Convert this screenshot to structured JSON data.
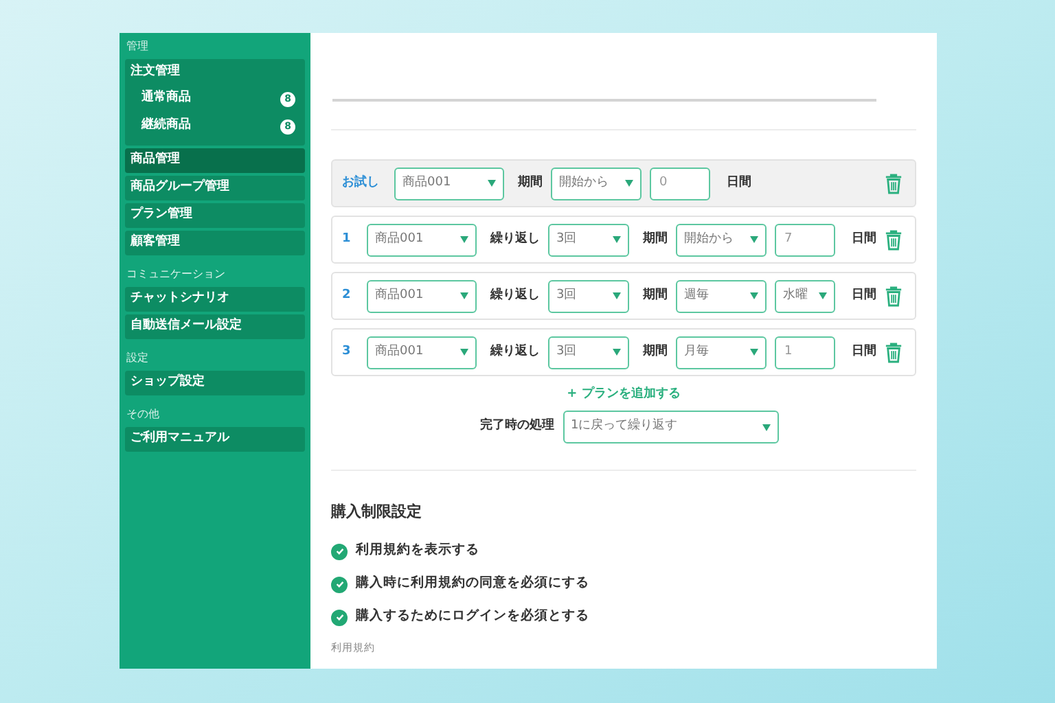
{
  "sidebar": {
    "sections": [
      {
        "label": "管理",
        "items": [
          {
            "label": "注文管理",
            "selected": false,
            "children": [
              {
                "label": "通常商品",
                "badge": "8",
                "selected": false
              },
              {
                "label": "継続商品",
                "badge": "8",
                "selected": false
              }
            ]
          },
          {
            "label": "商品管理",
            "selected": true
          },
          {
            "label": "商品グループ管理",
            "selected": false
          },
          {
            "label": "プラン管理",
            "selected": false
          },
          {
            "label": "顧客管理",
            "selected": false
          }
        ]
      },
      {
        "label": "コミュニケーション",
        "items": [
          {
            "label": "チャットシナリオ",
            "selected": false
          },
          {
            "label": "自動送信メール設定",
            "selected": false
          }
        ]
      },
      {
        "label": "設定",
        "items": [
          {
            "label": "ショップ設定",
            "selected": false
          }
        ]
      },
      {
        "label": "その他",
        "items": [
          {
            "label": "ご利用マニュアル",
            "selected": false
          }
        ]
      }
    ]
  },
  "plans": [
    {
      "kind": "trial",
      "label": "お試し",
      "product": "商品001",
      "period_label": "期間",
      "period": "開始から",
      "amount": {
        "kind": "input",
        "value": "0"
      },
      "unit": "日間"
    },
    {
      "kind": "repeat",
      "label": "1",
      "product": "商品001",
      "repeat_label": "繰り返し",
      "repeat": "3回",
      "period_label": "期間",
      "period": "開始から",
      "amount": {
        "kind": "input",
        "value": "7"
      },
      "unit": "日間"
    },
    {
      "kind": "repeat",
      "label": "2",
      "product": "商品001",
      "repeat_label": "繰り返し",
      "repeat": "3回",
      "period_label": "期間",
      "period": "週毎",
      "amount": {
        "kind": "select",
        "value": "水曜"
      },
      "unit": "日間"
    },
    {
      "kind": "repeat",
      "label": "3",
      "product": "商品001",
      "repeat_label": "繰り返し",
      "repeat": "3回",
      "period_label": "期間",
      "period": "月毎",
      "amount": {
        "kind": "input",
        "value": "1"
      },
      "unit": "日間"
    }
  ],
  "add_plan": "+ プランを追加する",
  "completion": {
    "label": "完了時の処理",
    "value": "1に戻って繰り返す"
  },
  "purchase_limits": {
    "title": "購入制限設定",
    "options": [
      {
        "label": "利用規約を表示する",
        "checked": true
      },
      {
        "label": "購入時に利用規約の同意を必須にする",
        "checked": true
      },
      {
        "label": "購入するためにログインを必須とする",
        "checked": true
      }
    ],
    "terms_label": "利用規約"
  }
}
